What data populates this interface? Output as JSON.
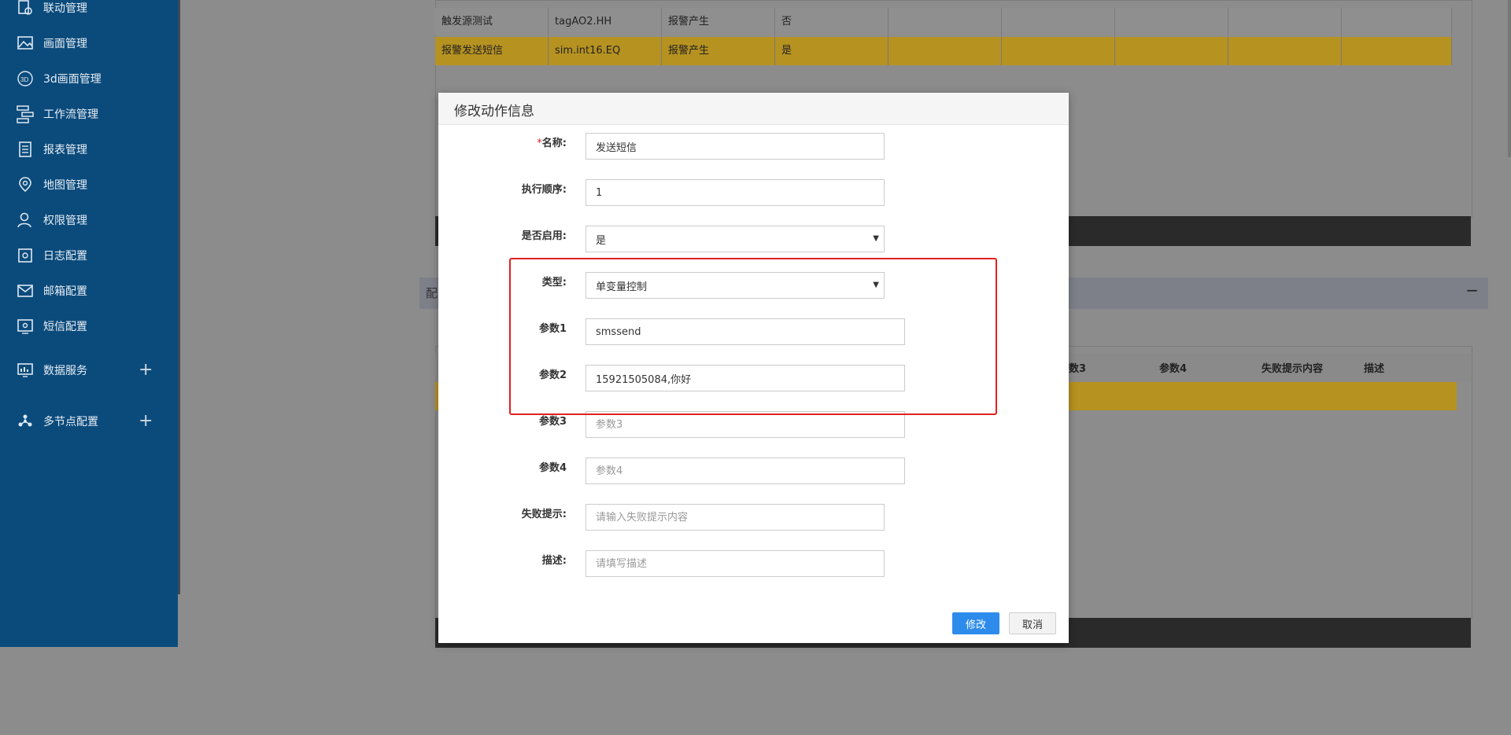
{
  "sidebar": {
    "items": [
      {
        "label": "联动管理",
        "icon": "linkage-icon"
      },
      {
        "label": "画面管理",
        "icon": "image-icon"
      },
      {
        "label": "3d画面管理",
        "icon": "3d-icon"
      },
      {
        "label": "工作流管理",
        "icon": "workflow-icon"
      },
      {
        "label": "报表管理",
        "icon": "report-icon"
      },
      {
        "label": "地图管理",
        "icon": "map-pin-icon"
      },
      {
        "label": "权限管理",
        "icon": "user-permission-icon"
      },
      {
        "label": "日志配置",
        "icon": "log-icon"
      },
      {
        "label": "邮箱配置",
        "icon": "mail-icon"
      },
      {
        "label": "短信配置",
        "icon": "sms-icon"
      },
      {
        "label": "数据服务",
        "icon": "chart-icon",
        "expand": "+"
      },
      {
        "label": "多节点配置",
        "icon": "nodes-icon",
        "expand": "+"
      }
    ]
  },
  "background": {
    "rows": [
      [
        "触发源测试",
        "tagAO2.HH",
        "报警产生",
        "否"
      ],
      [
        "报警发送短信",
        "sim.int16.EQ",
        "报警产生",
        "是"
      ]
    ],
    "section_title": "配",
    "section_toggle": "−",
    "headers2": [
      "数3",
      "参数4",
      "失败提示内容",
      "描述"
    ]
  },
  "modal": {
    "title": "修改动作信息",
    "fields": {
      "name": {
        "label": "名称:",
        "required_mark": "*",
        "value": "发送短信"
      },
      "order": {
        "label": "执行顺序:",
        "value": "1"
      },
      "enabled": {
        "label": "是否启用:",
        "value": "是"
      },
      "type": {
        "label": "类型:",
        "value": "单变量控制"
      },
      "param1": {
        "label": "参数1",
        "value": "smssend"
      },
      "param2": {
        "label": "参数2",
        "value": "15921505084,你好"
      },
      "param3": {
        "label": "参数3",
        "placeholder": "参数3"
      },
      "param4": {
        "label": "参数4",
        "placeholder": "参数4"
      },
      "fail_tip": {
        "label": "失败提示:",
        "placeholder": "请输入失败提示内容"
      },
      "desc": {
        "label": "描述:",
        "placeholder": "请填写描述"
      }
    },
    "buttons": {
      "submit": "修改",
      "cancel": "取消"
    }
  },
  "colors": {
    "sidebar_bg": "#0b4b7c",
    "highlight_row": "#b69220",
    "primary": "#2d8ceb",
    "annotation_border": "#e0211f"
  }
}
